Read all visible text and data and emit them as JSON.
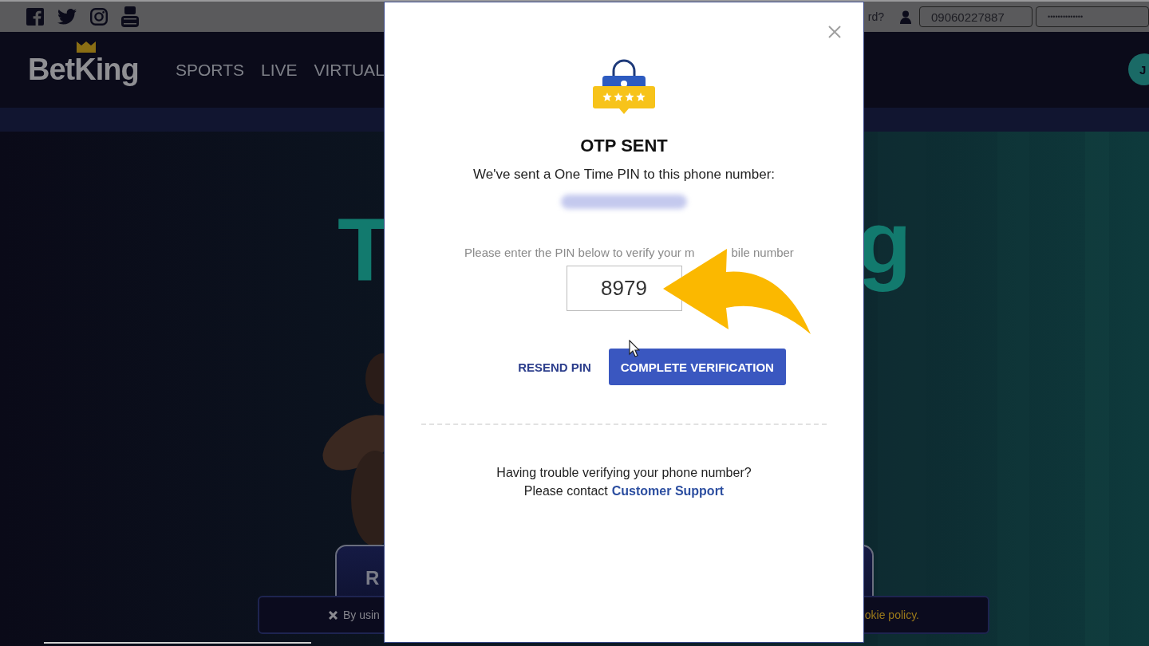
{
  "topbar": {
    "forgot_fragment": "rd?",
    "phone_value": "09060227887",
    "password_value": "••••••••••••••"
  },
  "nav": {
    "logo": "BetKing",
    "links": [
      "SPORTS",
      "LIVE",
      "VIRTUAL"
    ],
    "account_initial": "J"
  },
  "hero": {
    "heading_left": "T",
    "heading_right": "g",
    "button_fragment": "R",
    "cookie_left": "By usin",
    "cookie_right": "okie policy."
  },
  "modal": {
    "title": "OTP SENT",
    "message": "We've sent a One Time PIN to this phone number:",
    "instruction_before_arrow": "Please enter the PIN below to verify your m",
    "instruction_after_arrow": "bile number",
    "pin_value": "8979",
    "resend": "RESEND PIN",
    "submit": "COMPLETE VERIFICATION",
    "help_line": "Having trouble verifying your phone number?",
    "contact_prefix": "Please contact",
    "contact_link": "Customer Support"
  }
}
